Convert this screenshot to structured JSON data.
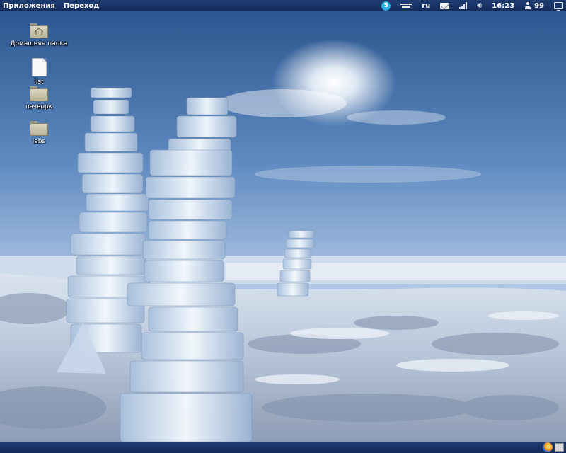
{
  "top_panel": {
    "menus": [
      "Приложения",
      "Переход"
    ],
    "keyboard_layout": "ru",
    "clock": "16:23",
    "user_count": "99",
    "icons": [
      "skype-icon",
      "network-icon",
      "mail-icon",
      "signal-icon",
      "volume-icon",
      "user-icon",
      "display-icon"
    ]
  },
  "desktop": {
    "icons": [
      {
        "label": "Домашняя папка",
        "icon": "home-folder-icon"
      },
      {
        "label": "list",
        "icon": "file-icon"
      },
      {
        "label": "пэчворк",
        "icon": "folder-icon"
      },
      {
        "label": "labs",
        "icon": "folder-icon"
      }
    ]
  },
  "bottom_panel": {
    "icons": [
      "firefox-icon",
      "trash-icon"
    ]
  },
  "colors": {
    "panel": "#1a3566",
    "sky_top": "#2f5a96",
    "sky_horizon": "#b9cde6",
    "ice": "#eaf3fb",
    "snow": "#d6dfec"
  }
}
